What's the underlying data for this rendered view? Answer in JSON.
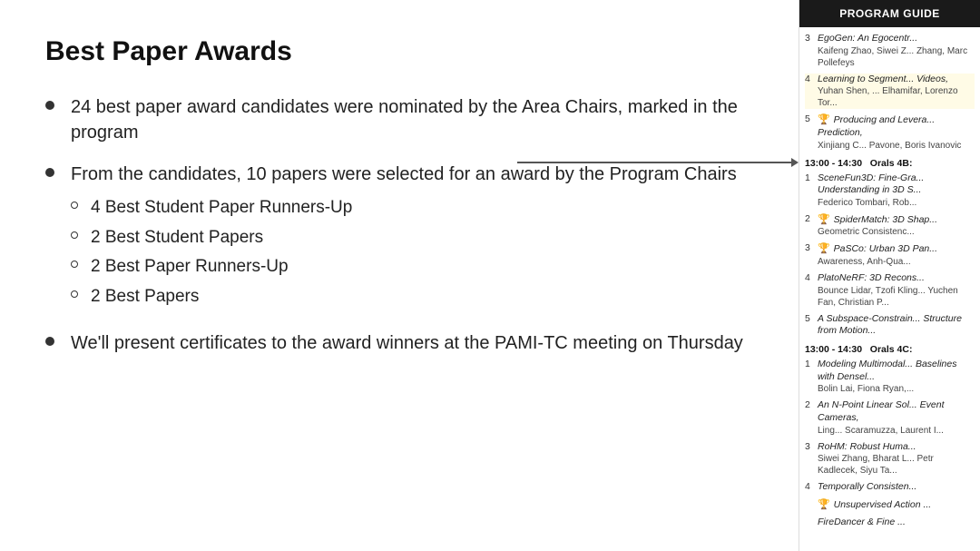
{
  "page": {
    "title": "Best Paper Awards"
  },
  "bullets": [
    {
      "text": "24 best paper award candidates were nominated by the Area Chairs, marked in the program"
    },
    {
      "text": "From the candidates, 10 papers were selected for an award by the Program Chairs",
      "sub": [
        "4 Best Student Paper Runners-Up",
        "2 Best Student Papers",
        "2 Best Paper Runners-Up",
        "2 Best Papers"
      ]
    },
    {
      "text": "We'll present certificates to the award winners at the PAMI-TC meeting on Thursday"
    }
  ],
  "sidebar": {
    "header": "PROGRAM GUIDE",
    "entries_top": [
      {
        "num": "3",
        "title": "EgoGen: An Egocentr...",
        "authors": "Kaifeng Zhao, Siwei Z... Zhang, Marc Pollefeys",
        "trophy": false
      },
      {
        "num": "4",
        "title": "Learning to Segment... Videos,",
        "authors": "Yuhan Shen, ... Elhamifar, Lorenzo Tor...",
        "trophy": false
      },
      {
        "num": "5",
        "title": "Producing and Levera... Prediction,",
        "authors": "Xinjiang C... Pavone, Boris Ivanovic",
        "trophy": true
      }
    ],
    "section1": "13:00 - 14:30    Orals 4B:",
    "entries_4b": [
      {
        "num": "1",
        "title": "SceneFun3D: Fine-Gra... Understanding in 3D S...",
        "authors": "Federico Tombari, Rob...",
        "trophy": false
      },
      {
        "num": "2",
        "title": "SpiderMatch: 3D Shap...",
        "authors": "",
        "trophy": true
      },
      {
        "num": "3",
        "title": "PaSCo: Urban 3D Pan...",
        "authors": "",
        "trophy": true
      },
      {
        "num": "4",
        "title": "PlatoNeRF: 3D Recons...",
        "authors": "",
        "trophy": false
      },
      {
        "num": "",
        "title": "Bounce Lidar, Tzofi Kling... Yuchen Fan, Christian P...",
        "authors": "",
        "trophy": false
      },
      {
        "num": "5",
        "title": "A Subspace-Constrain... Structure from Motion...",
        "authors": "",
        "trophy": false
      }
    ],
    "section2": "13:00 - 14:30    Orals 4C:",
    "entries_4c": [
      {
        "num": "1",
        "title": "Modeling Multimodal... Baselines with Densel...",
        "authors": "Bolin Lai, Fiona Ryan,...",
        "trophy": false
      },
      {
        "num": "2",
        "title": "An N-Point Linear Sol... Event Cameras,",
        "authors": "Ling... Scaramuzza, Laurent I...",
        "trophy": false
      },
      {
        "num": "3",
        "title": "RoHM: Robust Huma...",
        "authors": "Siwei Zhang, Bharat L... Petr Kadlecek, Siyu Ta...",
        "trophy": false
      },
      {
        "num": "4",
        "title": "Temporally Consisten...",
        "authors": "",
        "trophy": false
      },
      {
        "num": "",
        "title": "Unsupervised Action ...",
        "authors": "",
        "trophy": true
      },
      {
        "num": "",
        "title": "FireDancer & Fine ...",
        "authors": "",
        "trophy": false
      }
    ]
  }
}
